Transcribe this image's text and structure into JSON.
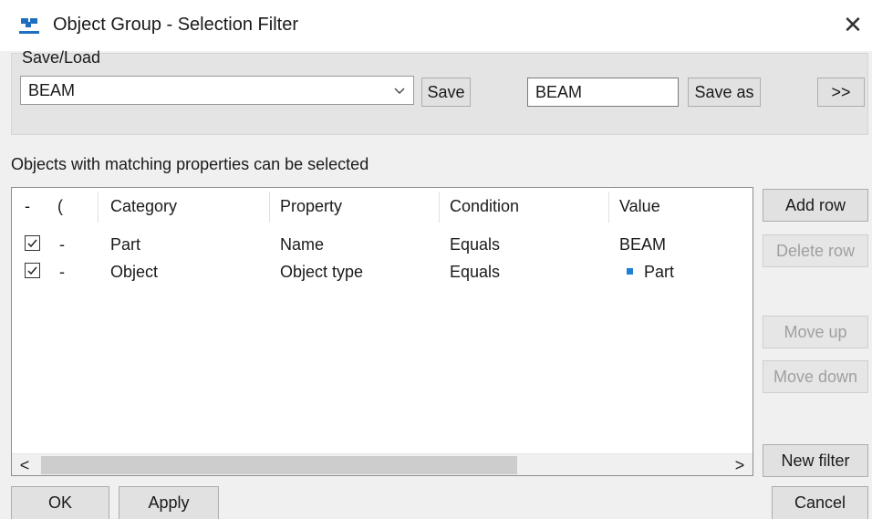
{
  "window": {
    "title": "Object Group - Selection Filter",
    "close_glyph": "✕",
    "icon": "tekla-app-icon"
  },
  "save_load": {
    "caption": "Save/Load",
    "selected": "BEAM",
    "save_label": "Save",
    "name_value": "BEAM",
    "save_as_label": "Save as",
    "expand_label": ">>"
  },
  "info_text": "Objects with matching properties can be selected",
  "table": {
    "headers": [
      "-",
      "(",
      "Category",
      "Property",
      "Condition",
      "Value"
    ],
    "rows": [
      {
        "checked": true,
        "paren": "-",
        "category": "Part",
        "property": "Name",
        "condition": "Equals",
        "value": "BEAM",
        "value_icon": ""
      },
      {
        "checked": true,
        "paren": "-",
        "category": "Object",
        "property": "Object type",
        "condition": "Equals",
        "value": "Part",
        "value_icon": "blue-square-icon"
      }
    ],
    "scroll_left": "<",
    "scroll_right": ">"
  },
  "side_buttons": {
    "add_row": "Add row",
    "delete_row": "Delete row",
    "move_up": "Move up",
    "move_down": "Move down",
    "new_filter": "New filter"
  },
  "bottom_buttons": {
    "ok": "OK",
    "apply": "Apply",
    "cancel": "Cancel"
  },
  "colors": {
    "accent": "#1e7fd6",
    "dialog_bg": "#f0f0f0",
    "disabled_text": "#a0a0a0"
  }
}
